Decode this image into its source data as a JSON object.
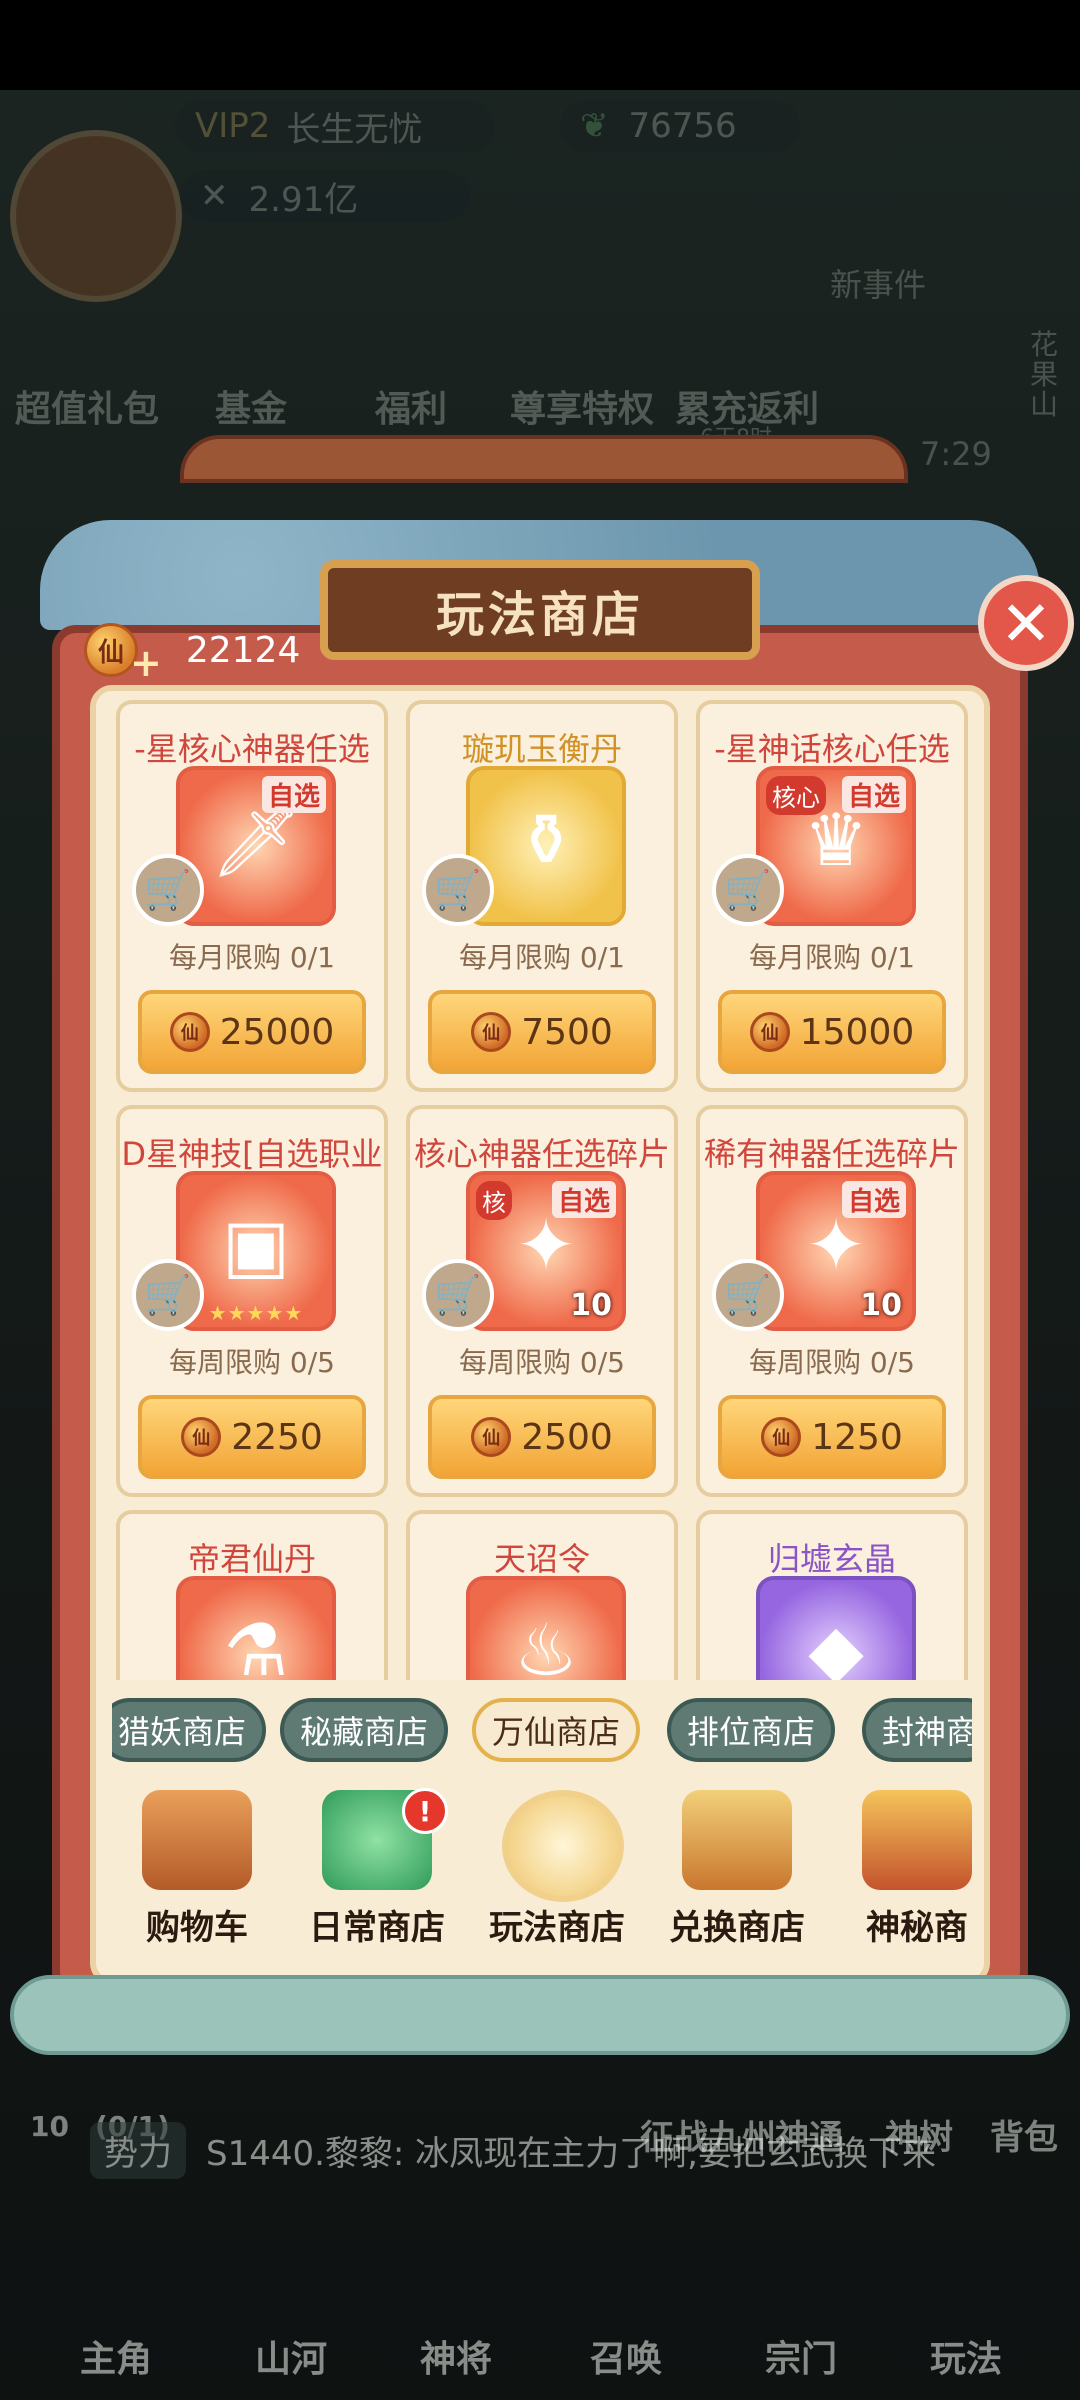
{
  "hud": {
    "vip": "VIP2",
    "vip_title": "长生无忧",
    "jade": "76756",
    "power": "2.91亿",
    "event_label": "新事件",
    "timer": "7:29",
    "side_right": "花果山",
    "icons": [
      "超值礼包",
      "基金",
      "福利",
      "尊享特权",
      "累充返利"
    ],
    "sub_note": "6天8时"
  },
  "shop": {
    "title": "玩法商店",
    "currency_icon": "仙",
    "currency_value": "22124",
    "coin_glyph": "仙",
    "close_label": "✕",
    "items": [
      {
        "name": "-星核心神器任选",
        "tag": "自选",
        "core": "",
        "qty": "",
        "limit": "每月限购 0/1",
        "price": "25000",
        "theme": "red",
        "glyph": "🗡"
      },
      {
        "name": "璇玑玉衡丹",
        "tag": "",
        "core": "",
        "qty": "",
        "limit": "每月限购 0/1",
        "price": "7500",
        "theme": "gold",
        "glyph": "⚱"
      },
      {
        "name": "-星神话核心任选",
        "tag": "自选",
        "core": "核心",
        "qty": "",
        "limit": "每月限购 0/1",
        "price": "15000",
        "theme": "red",
        "glyph": "♛"
      },
      {
        "name": "D星神技[自选职业",
        "tag": "",
        "core": "",
        "qty": "",
        "limit": "每周限购 0/5",
        "price": "2250",
        "theme": "red",
        "glyph": "▣"
      },
      {
        "name": "核心神器任选碎片",
        "tag": "自选",
        "core": "核",
        "qty": "10",
        "limit": "每周限购 0/5",
        "price": "2500",
        "theme": "red",
        "glyph": "✦"
      },
      {
        "name": "稀有神器任选碎片",
        "tag": "自选",
        "core": "",
        "qty": "10",
        "limit": "每周限购 0/5",
        "price": "1250",
        "theme": "red",
        "glyph": "✦"
      },
      {
        "name": "帝君仙丹",
        "tag": "",
        "core": "",
        "qty": "",
        "limit": "",
        "price": "",
        "theme": "red",
        "glyph": "⚗"
      },
      {
        "name": "天诏令",
        "tag": "",
        "core": "",
        "qty": "",
        "limit": "",
        "price": "",
        "theme": "red",
        "glyph": "♨"
      },
      {
        "name": "归墟玄晶",
        "tag": "",
        "core": "",
        "qty": "",
        "limit": "",
        "price": "",
        "theme": "purple",
        "glyph": "◆"
      }
    ],
    "sub_tabs": [
      "猎妖商店",
      "秘藏商店",
      "万仙商店",
      "排位商店",
      "封神商"
    ],
    "active_sub_tab": 2,
    "shops": [
      {
        "label": "购物车",
        "badge": ""
      },
      {
        "label": "日常商店",
        "badge": "!"
      },
      {
        "label": "玩法商店",
        "badge": ""
      },
      {
        "label": "兑换商店",
        "badge": ""
      },
      {
        "label": "神秘商",
        "badge": ""
      }
    ],
    "active_shop": 2
  },
  "bottom": {
    "task_count": "10",
    "task_progress": "(0/1)",
    "quick_links": [
      "征战九州",
      "神通",
      "神树",
      "背包"
    ],
    "chat_tag": "势力",
    "chat_text": "S1440.黎黎:  冰凤现在主力了啊,要把玄武换下来",
    "nav": [
      "主角",
      "山河",
      "神将",
      "召唤",
      "宗门",
      "玩法"
    ]
  },
  "colors": {
    "frame": "#c55b4a",
    "inner": "#f8ecd4",
    "price_button": "#f2a536",
    "accent_red": "#d0463c"
  }
}
